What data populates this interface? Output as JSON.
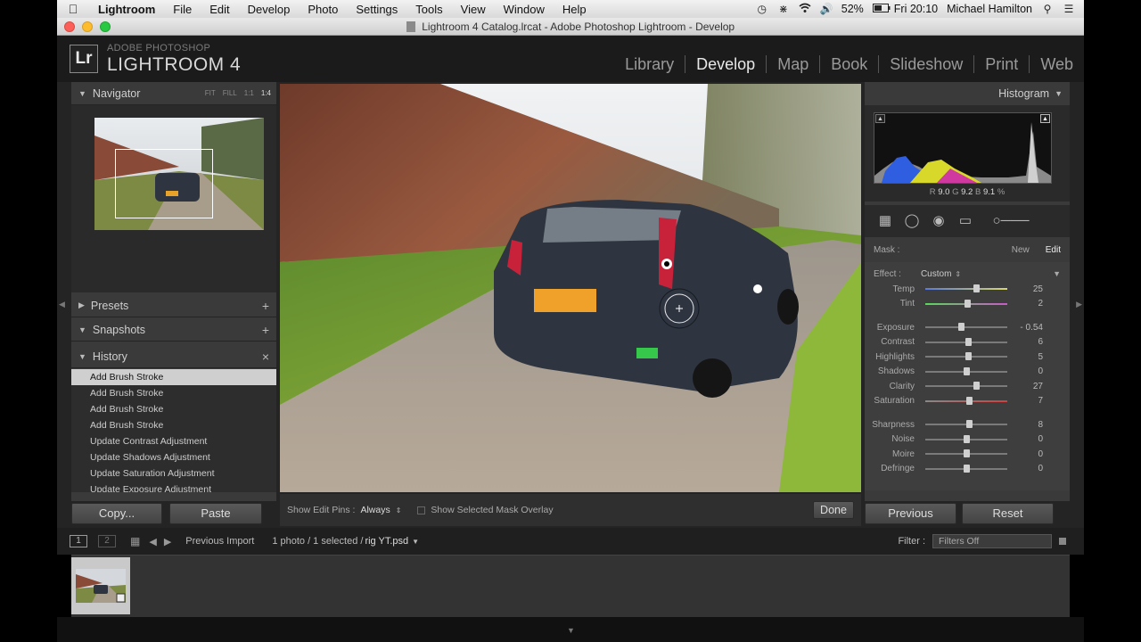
{
  "menubar": {
    "items": [
      "Lightroom",
      "File",
      "Edit",
      "Develop",
      "Photo",
      "Settings",
      "Tools",
      "View",
      "Window",
      "Help"
    ],
    "battery": "52%",
    "clock": "Fri 20:10",
    "user": "Michael Hamilton"
  },
  "window": {
    "title": "Lightroom 4 Catalog.lrcat - Adobe Photoshop Lightroom - Develop"
  },
  "brand": {
    "logo": "Lr",
    "top": "ADOBE PHOTOSHOP",
    "main": "LIGHTROOM 4"
  },
  "modules": [
    "Library",
    "Develop",
    "Map",
    "Book",
    "Slideshow",
    "Print",
    "Web"
  ],
  "navigator": {
    "title": "Navigator",
    "zoom": [
      "FIT",
      "FILL",
      "1:1",
      "1:4"
    ]
  },
  "panels": {
    "presets": "Presets",
    "snapshots": "Snapshots",
    "history": "History"
  },
  "history": [
    "Add Brush Stroke",
    "Add Brush Stroke",
    "Add Brush Stroke",
    "Add Brush Stroke",
    "Update Contrast Adjustment",
    "Update Shadows Adjustment",
    "Update Saturation Adjustment",
    "Update Exposure Adjustment"
  ],
  "left_buttons": {
    "copy": "Copy...",
    "paste": "Paste"
  },
  "toolbar": {
    "show_pins_label": "Show Edit Pins :",
    "show_pins_value": "Always",
    "mask_overlay": "Show Selected Mask Overlay",
    "done": "Done"
  },
  "histogram": {
    "title": "Histogram",
    "r_label": "R",
    "r": "9.0",
    "g_label": "G",
    "g": "9.2",
    "b_label": "B",
    "b": "9.1",
    "pct": "%"
  },
  "mask": {
    "label": "Mask :",
    "new": "New",
    "edit": "Edit"
  },
  "effect": {
    "label": "Effect :",
    "value": "Custom"
  },
  "sliders": [
    {
      "label": "Temp",
      "value": "25",
      "pos": 0.62
    },
    {
      "label": "Tint",
      "value": "2",
      "pos": 0.51
    },
    {
      "label": "Exposure",
      "value": "- 0.54",
      "pos": 0.44
    },
    {
      "label": "Contrast",
      "value": "6",
      "pos": 0.52
    },
    {
      "label": "Highlights",
      "value": "5",
      "pos": 0.52
    },
    {
      "label": "Shadows",
      "value": "0",
      "pos": 0.5
    },
    {
      "label": "Clarity",
      "value": "27",
      "pos": 0.62
    },
    {
      "label": "Saturation",
      "value": "7",
      "pos": 0.53
    },
    {
      "label": "Sharpness",
      "value": "8",
      "pos": 0.53
    },
    {
      "label": "Noise",
      "value": "0",
      "pos": 0.5
    },
    {
      "label": "Moire",
      "value": "0",
      "pos": 0.5
    },
    {
      "label": "Defringe",
      "value": "0",
      "pos": 0.5
    }
  ],
  "right_buttons": {
    "previous": "Previous",
    "reset": "Reset"
  },
  "filmstrip": {
    "page1": "1",
    "page2": "2",
    "source": "Previous Import",
    "count": "1 photo / 1 selected /",
    "filename": "rig YT.psd",
    "filter_label": "Filter :",
    "filter_value": "Filters Off"
  }
}
